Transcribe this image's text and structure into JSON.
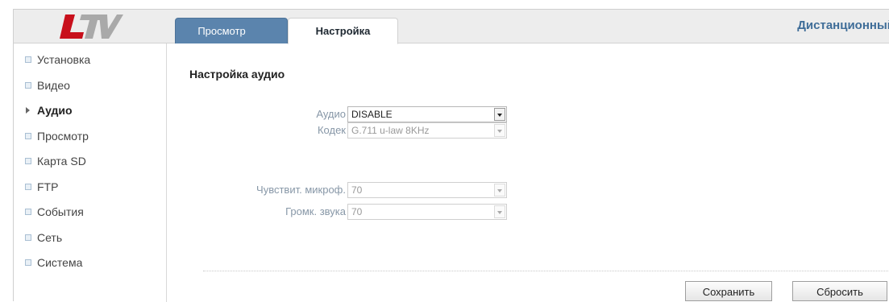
{
  "header": {
    "tabs": [
      {
        "label": "Просмотр",
        "active": false
      },
      {
        "label": "Настройка",
        "active": true
      }
    ],
    "title": "Дистанционный"
  },
  "sidebar": {
    "items": [
      {
        "label": "Установка",
        "active": false
      },
      {
        "label": "Видео",
        "active": false
      },
      {
        "label": "Аудио",
        "active": true
      },
      {
        "label": "Просмотр",
        "active": false
      },
      {
        "label": "Карта SD",
        "active": false
      },
      {
        "label": "FTP",
        "active": false
      },
      {
        "label": "События",
        "active": false
      },
      {
        "label": "Сеть",
        "active": false
      },
      {
        "label": "Система",
        "active": false
      }
    ]
  },
  "main": {
    "section_title": "Настройка аудио",
    "fields": {
      "audio": {
        "label": "Аудио",
        "value": "DISABLE",
        "enabled": true
      },
      "codec": {
        "label": "Кодек",
        "value": "G.711 u-law 8KHz",
        "enabled": false
      },
      "mic_sensitivity": {
        "label": "Чувствит. микроф.",
        "value": "70",
        "enabled": false
      },
      "volume": {
        "label": "Громк. звука",
        "value": "70",
        "enabled": false
      }
    },
    "buttons": {
      "save": "Сохранить",
      "reset": "Сбросить"
    }
  },
  "colors": {
    "active_tab_bg": "#5b84ad",
    "header_title": "#3f6d98",
    "logo_red": "#c8101c",
    "logo_gray": "#a7a7a7"
  },
  "icons": {
    "logo": "ltv-logo",
    "menu_bullet": "square-bullet-icon",
    "active_marker": "arrow-right-icon",
    "dropdown": "chevron-down-icon"
  }
}
